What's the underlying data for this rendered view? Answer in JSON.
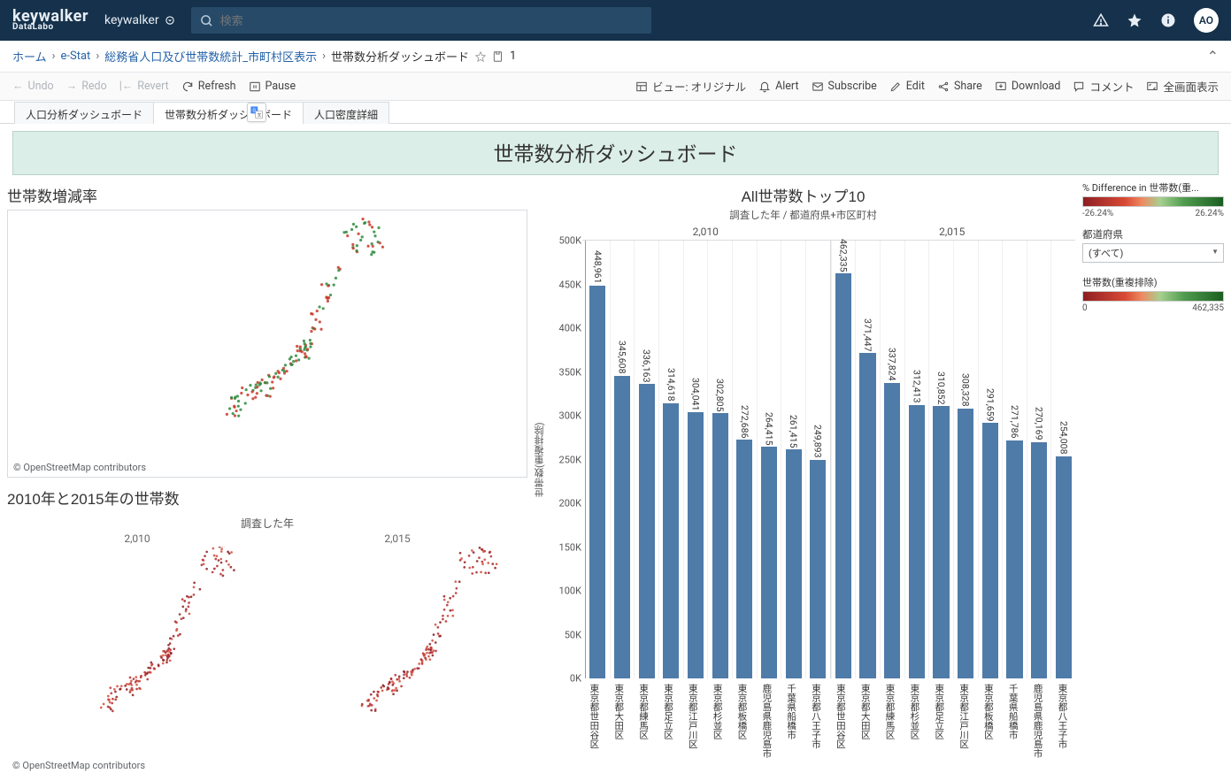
{
  "brand": {
    "main": "keywalker",
    "sub": "DataLabo"
  },
  "workspace": "keywalker",
  "search": {
    "placeholder": "検索"
  },
  "avatar": "AO",
  "breadcrumb": {
    "home": "ホーム",
    "l1": "e-Stat",
    "l2": "総務省人口及び世帯数統計_市町村区表示",
    "l3": "世帯数分析ダッシュボード",
    "views": "1"
  },
  "toolbar": {
    "undo": "Undo",
    "redo": "Redo",
    "revert": "Revert",
    "refresh": "Refresh",
    "pause": "Pause",
    "view": "ビュー: オリジナル",
    "alert": "Alert",
    "subscribe": "Subscribe",
    "edit": "Edit",
    "share": "Share",
    "download": "Download",
    "comment": "コメント",
    "fullscreen": "全画面表示"
  },
  "tabs": {
    "t1": "人口分析ダッシュボード",
    "t2": "世帯数分析ダッシュボード",
    "t3": "人口密度詳細"
  },
  "dashboard_title": "世帯数分析ダッシュボード",
  "sections": {
    "growth": "世帯数増減率",
    "compare": "2010年と2015年の世帯数",
    "compare_hdr": "調査した年",
    "top10": "All世帯数トップ10",
    "top10_sub": "調査した年 / 都道府県+市区町村"
  },
  "attrib": "© OpenStreetMap contributors",
  "years": {
    "y1": "2,010",
    "y2": "2,015"
  },
  "chart_data": {
    "type": "bar",
    "ylabel": "世帯数(重複排除)",
    "ylim": [
      0,
      500000
    ],
    "yticks": [
      "0K",
      "50K",
      "100K",
      "150K",
      "200K",
      "250K",
      "300K",
      "350K",
      "400K",
      "450K",
      "500K"
    ],
    "groups": [
      {
        "name": "2,010",
        "bars": [
          {
            "label": "東京都世田谷区",
            "value": 448961,
            "text": "448,961"
          },
          {
            "label": "東京都大田区",
            "value": 345608,
            "text": "345,608"
          },
          {
            "label": "東京都練馬区",
            "value": 336163,
            "text": "336,163"
          },
          {
            "label": "東京都足立区",
            "value": 314618,
            "text": "314,618"
          },
          {
            "label": "東京都江戸川区",
            "value": 304041,
            "text": "304,041"
          },
          {
            "label": "東京都杉並区",
            "value": 302805,
            "text": "302,805"
          },
          {
            "label": "東京都板橋区",
            "value": 272686,
            "text": "272,686"
          },
          {
            "label": "鹿児島県鹿児島市",
            "value": 264415,
            "text": "264,415"
          },
          {
            "label": "千葉県船橋市",
            "value": 261415,
            "text": "261,415"
          },
          {
            "label": "東京都八王子市",
            "value": 249893,
            "text": "249,893"
          }
        ]
      },
      {
        "name": "2,015",
        "bars": [
          {
            "label": "東京都世田谷区",
            "value": 462335,
            "text": "462,335"
          },
          {
            "label": "東京都大田区",
            "value": 371447,
            "text": "371,447"
          },
          {
            "label": "東京都練馬区",
            "value": 337824,
            "text": "337,824"
          },
          {
            "label": "東京都杉並区",
            "value": 312413,
            "text": "312,413"
          },
          {
            "label": "東京都足立区",
            "value": 310852,
            "text": "310,852"
          },
          {
            "label": "東京都江戸川区",
            "value": 308328,
            "text": "308,328"
          },
          {
            "label": "東京都板橋区",
            "value": 291659,
            "text": "291,659"
          },
          {
            "label": "千葉県船橋市",
            "value": 271786,
            "text": "271,786"
          },
          {
            "label": "鹿児島県鹿児島市",
            "value": 270169,
            "text": "270,169"
          },
          {
            "label": "東京都八王子市",
            "value": 254008,
            "text": "254,008"
          }
        ]
      }
    ]
  },
  "legend": {
    "diff_title": "% Difference in 世帯数(重...",
    "diff_min": "-26.24%",
    "diff_max": "26.24%",
    "pref": "都道府県",
    "pref_val": "(すべて)",
    "count_title": "世帯数(重複排除)",
    "count_min": "0",
    "count_max": "462,335"
  }
}
